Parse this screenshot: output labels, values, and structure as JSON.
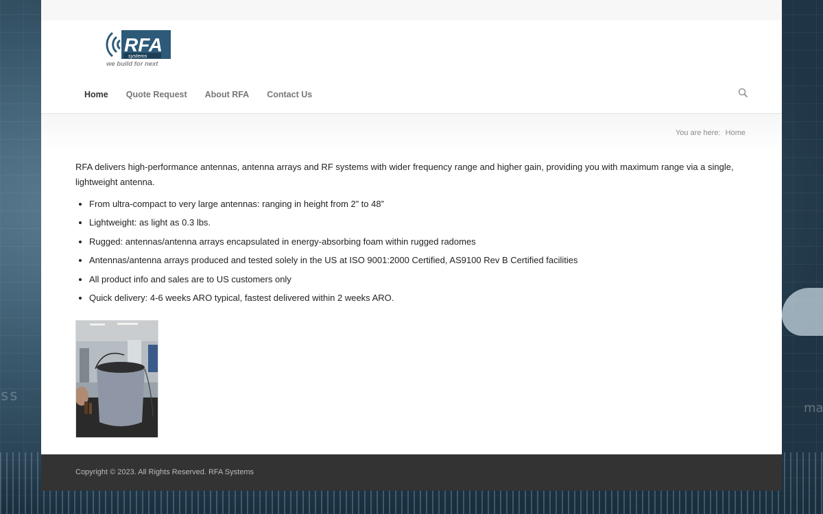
{
  "brand": {
    "logo_text": "RFA",
    "logo_subtext": "systems",
    "tagline": "we build for next",
    "accent_color": "#2d5a78"
  },
  "nav": {
    "items": [
      {
        "label": "Home",
        "active": true
      },
      {
        "label": "Quote Request",
        "active": false
      },
      {
        "label": "About RFA",
        "active": false
      },
      {
        "label": "Contact Us",
        "active": false
      }
    ],
    "search_icon": "search-icon"
  },
  "breadcrumb": {
    "prefix": "You are here:",
    "current": "Home"
  },
  "main": {
    "intro": "RFA delivers high-performance antennas, antenna arrays and RF systems with wider frequency range and higher gain, providing you with maximum range via a single, lightweight antenna.",
    "features": [
      "From ultra-compact to very large antennas: ranging in height from 2” to 48”",
      "Lightweight: as light as 0.3 lbs.",
      "Rugged: antennas/antenna arrays encapsulated in energy-absorbing foam within rugged radomes",
      "Antennas/antenna arrays produced and tested solely in the US at ISO 9001:2000 Certified, AS9100 Rev B Certified facilities",
      "All product info and sales are to US customers only",
      "Quick delivery: 4-6 weeks ARO typical, fastest delivered within 2 weeks ARO."
    ]
  },
  "footer": {
    "copyright": "Copyright © 2023. All Rights Reserved. RFA Systems"
  },
  "background": {
    "left_text": "ss",
    "right_text": "ma"
  }
}
